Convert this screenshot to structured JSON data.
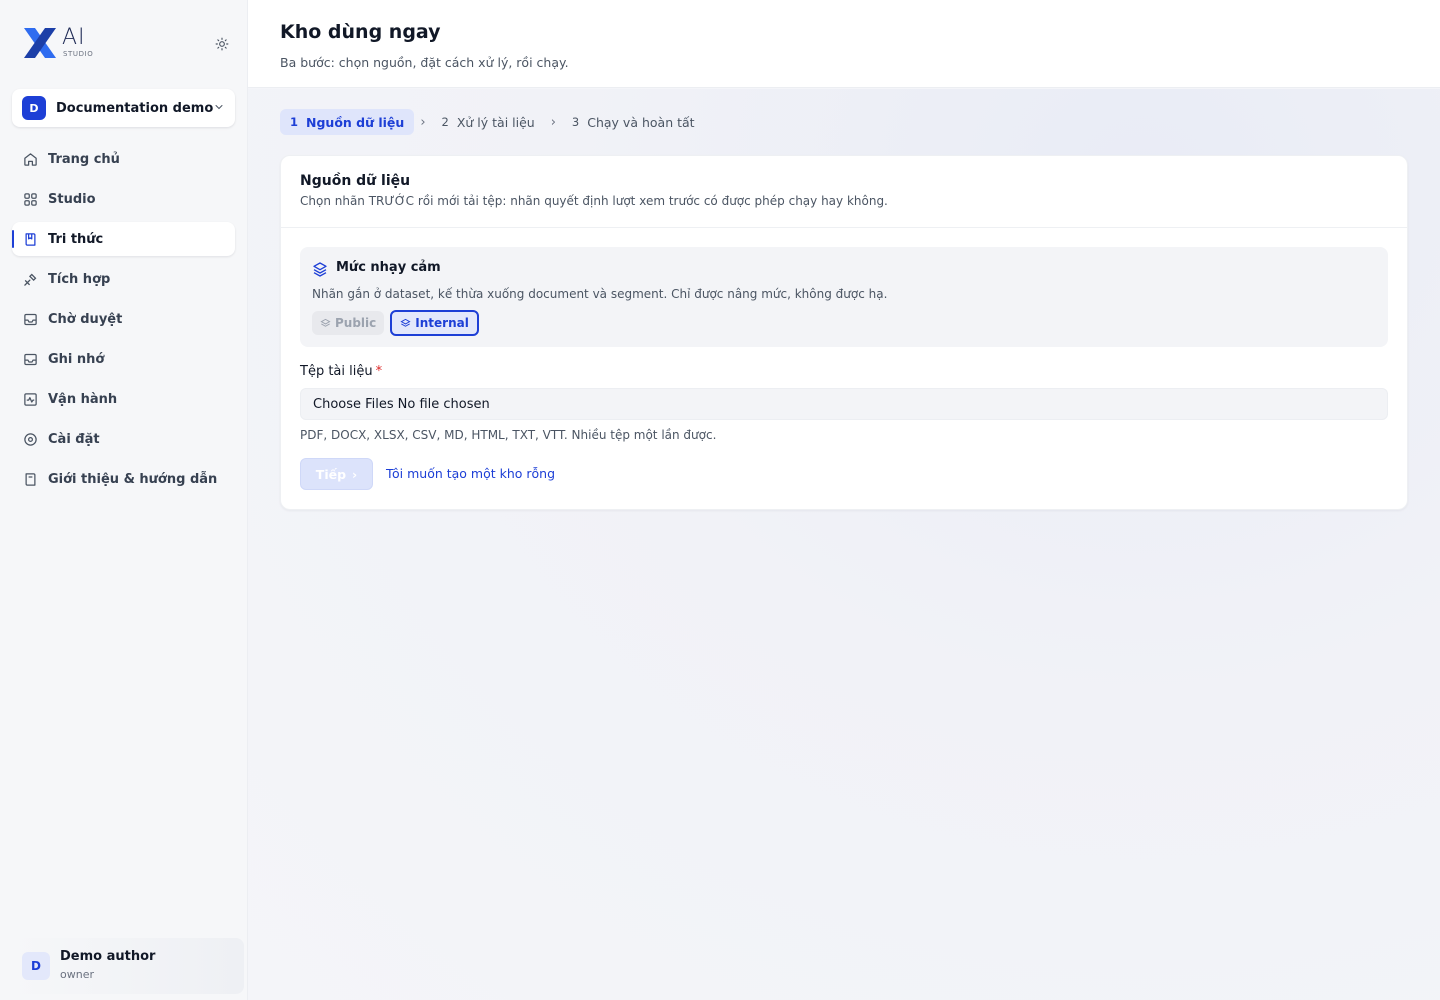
{
  "brand": {
    "name": "AI",
    "sub": "STUDIO"
  },
  "workspace": {
    "initial": "D",
    "name": "Documentation demo"
  },
  "nav": [
    {
      "label": "Trang chủ",
      "icon": "home-icon",
      "active": false
    },
    {
      "label": "Studio",
      "icon": "grid-icon",
      "active": false
    },
    {
      "label": "Tri thức",
      "icon": "book-icon",
      "active": true
    },
    {
      "label": "Tích hợp",
      "icon": "tools-icon",
      "active": false
    },
    {
      "label": "Chờ duyệt",
      "icon": "inbox-icon",
      "active": false
    },
    {
      "label": "Ghi nhớ",
      "icon": "inbox-icon",
      "active": false
    },
    {
      "label": "Vận hành",
      "icon": "activity-icon",
      "active": false
    },
    {
      "label": "Cài đặt",
      "icon": "settings-icon",
      "active": false
    },
    {
      "label": "Giới thiệu & hướng dẫn",
      "icon": "guide-icon",
      "active": false
    }
  ],
  "user": {
    "initial": "D",
    "name": "Demo author",
    "role": "owner"
  },
  "header": {
    "title": "Kho dùng ngay",
    "subtitle": "Ba bước: chọn nguồn, đặt cách xử lý, rồi chạy."
  },
  "steps": [
    {
      "num": "1",
      "label": "Nguồn dữ liệu",
      "active": true
    },
    {
      "num": "2",
      "label": "Xử lý tài liệu",
      "active": false
    },
    {
      "num": "3",
      "label": "Chạy và hoàn tất",
      "active": false
    }
  ],
  "step_separator": "›",
  "card": {
    "title": "Nguồn dữ liệu",
    "description": "Chọn nhãn TRƯỚC rồi mới tải tệp: nhãn quyết định lượt xem trước có được phép chạy hay không."
  },
  "sensitivity": {
    "title": "Mức nhạy cảm",
    "description": "Nhãn gắn ở dataset, kế thừa xuống document và segment. Chỉ được nâng mức, không được hạ.",
    "options": [
      {
        "label": "Public",
        "state": "disabled"
      },
      {
        "label": "Internal",
        "state": "selected"
      }
    ]
  },
  "file": {
    "label": "Tệp tài liệu",
    "required_mark": "*",
    "button_text": "Choose Files",
    "status_text": "No file chosen",
    "hint": "PDF, DOCX, XLSX, CSV, MD, HTML, TXT, VTT. Nhiều tệp một lần được."
  },
  "actions": {
    "next_label": "Tiếp",
    "next_arrow": "›",
    "empty_link": "Tôi muốn tạo một kho rỗng"
  },
  "colors": {
    "accent": "#1d3fd6",
    "required": "#dc2626",
    "accent_soft": "#dfe5fb"
  }
}
